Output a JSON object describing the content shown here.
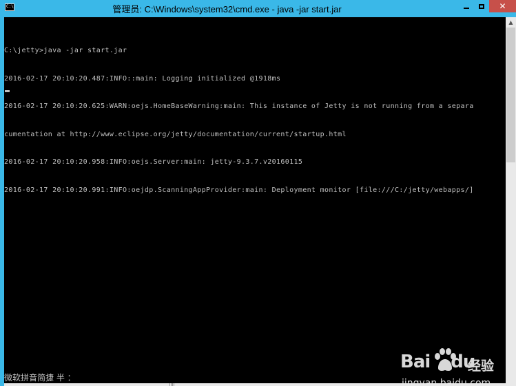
{
  "window": {
    "title": "管理员: C:\\Windows\\system32\\cmd.exe - java  -jar start.jar",
    "app_icon": "cmd-icon",
    "app_icon_text": "C:\\",
    "titlebar_color": "#3ab8e8",
    "close_color": "#c7504a"
  },
  "controls": {
    "minimize_icon": "minimize-icon",
    "maximize_icon": "maximize-icon",
    "close_icon": "close-icon",
    "close_glyph": "✕"
  },
  "console": {
    "background": "#000000",
    "foreground": "#c0c0c0",
    "lines": [
      "C:\\jetty>java -jar start.jar",
      "2016-02-17 20:10:20.487:INFO::main: Logging initialized @1918ms",
      "2016-02-17 20:10:20.625:WARN:oejs.HomeBaseWarning:main: This instance of Jetty is not running from a separa",
      "cumentation at http://www.eclipse.org/jetty/documentation/current/startup.html",
      "2016-02-17 20:10:20.958:INFO:oejs.Server:main: jetty-9.3.7.v20160115",
      "2016-02-17 20:10:20.991:INFO:oejdp.ScanningAppProvider:main: Deployment monitor [file:///C:/jetty/webapps/]"
    ],
    "ime_status": "微软拼音简捷 半 ："
  },
  "scrollbar": {
    "up_arrow": "▲",
    "down_arrow": "▼"
  },
  "watermark": {
    "logo_text": "Bai",
    "logo_suffix": "du",
    "product": "经验",
    "url": "jingyan.baidu.com"
  }
}
